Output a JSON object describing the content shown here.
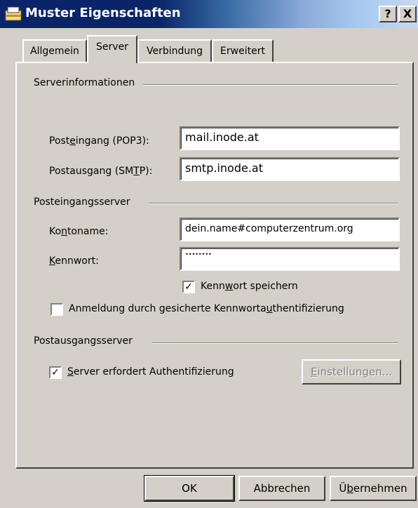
{
  "window": {
    "title": "Muster Eigenschaften",
    "help_glyph": "?",
    "close_glyph": "X"
  },
  "tabs": [
    {
      "label": "Allgemein",
      "active": false
    },
    {
      "label": "Server",
      "active": true
    },
    {
      "label": "Verbindung",
      "active": false
    },
    {
      "label": "Erweitert",
      "active": false
    }
  ],
  "server_info": {
    "group_label": "Serverinformationen",
    "incoming_label": {
      "pre": "Post",
      "u": "e",
      "post": "ingang (POP3):"
    },
    "incoming_value": "mail.inode.at",
    "outgoing_label": {
      "pre": "Postausgang (SM",
      "u": "T",
      "post": "P):"
    },
    "outgoing_value": "smtp.inode.at"
  },
  "incoming_server": {
    "group_label": "Posteingangsserver",
    "account_label": {
      "pre": "Ko",
      "u": "n",
      "post": "toname:"
    },
    "account_value": "dein.name#computerzentrum.org",
    "password_label": {
      "pre": "",
      "u": "K",
      "post": "ennwort:"
    },
    "password_value": "••••••••",
    "remember_label": {
      "pre": "Kenn",
      "u": "w",
      "post": "ort speichern"
    },
    "remember_checked": true,
    "spa_label": {
      "pre": "Anmeldung durch gesicherte Kennworta",
      "u": "u",
      "post": "thentifizierung"
    },
    "spa_checked": false
  },
  "outgoing_server": {
    "group_label": "Postausgangsserver",
    "auth_label": {
      "pre": "",
      "u": "S",
      "post": "erver erfordert Authentifizierung"
    },
    "auth_checked": true,
    "settings_button": {
      "pre": "",
      "u": "E",
      "post": "instellungen..."
    }
  },
  "footer": {
    "ok": "OK",
    "cancel": "Abbrechen",
    "apply": {
      "pre": "Ü",
      "u": "b",
      "post": "ernehmen"
    }
  }
}
